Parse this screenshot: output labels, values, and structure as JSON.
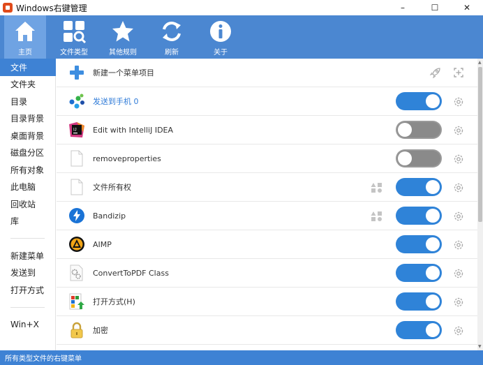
{
  "window": {
    "title": "Windows右键管理",
    "minimize": "–",
    "maximize": "☐",
    "close": "✕"
  },
  "toolbar": {
    "items": [
      {
        "label": "主页",
        "icon": "home-icon",
        "active": true
      },
      {
        "label": "文件类型",
        "icon": "file-type-search-icon",
        "active": false
      },
      {
        "label": "其他规则",
        "icon": "star-icon",
        "active": false
      },
      {
        "label": "刷新",
        "icon": "refresh-icon",
        "active": false
      },
      {
        "label": "关于",
        "icon": "info-icon",
        "active": false
      }
    ]
  },
  "sidebar": {
    "group1": [
      "文件",
      "文件夹",
      "目录",
      "目录背景",
      "桌面背景",
      "磁盘分区",
      "所有对象",
      "此电脑",
      "回收站",
      "库"
    ],
    "group2": [
      "新建菜单",
      "发送到",
      "打开方式"
    ],
    "group3": [
      "Win+X"
    ],
    "active": "文件"
  },
  "list": {
    "new_item_label": "新建一个菜单项目",
    "rows": [
      {
        "label": "发送到手机 0",
        "icon": "send-to-phone-icon",
        "enabled": true,
        "extra": false
      },
      {
        "label": "Edit with IntelliJ IDEA",
        "icon": "intellij-idea-icon",
        "enabled": false,
        "extra": false
      },
      {
        "label": "removeproperties",
        "icon": "blank-file-icon",
        "enabled": false,
        "extra": false
      },
      {
        "label": "文件所有权",
        "icon": "blank-file-icon",
        "enabled": true,
        "extra": true
      },
      {
        "label": "Bandizip",
        "icon": "bandizip-icon",
        "enabled": true,
        "extra": true
      },
      {
        "label": "AIMP",
        "icon": "aimp-icon",
        "enabled": true,
        "extra": false
      },
      {
        "label": "ConvertToPDF Class",
        "icon": "gears-file-icon",
        "enabled": true,
        "extra": false
      },
      {
        "label": "打开方式(H)",
        "icon": "open-with-icon",
        "enabled": true,
        "extra": false
      },
      {
        "label": "加密",
        "icon": "lock-icon",
        "enabled": true,
        "extra": false
      }
    ]
  },
  "status": {
    "text": "所有类型文件的右键菜单"
  },
  "colors": {
    "toolbar": "#4b87d1",
    "accent": "#3e82d4",
    "toggle_on": "#2f83d8",
    "toggle_off": "#8a8a8a"
  }
}
